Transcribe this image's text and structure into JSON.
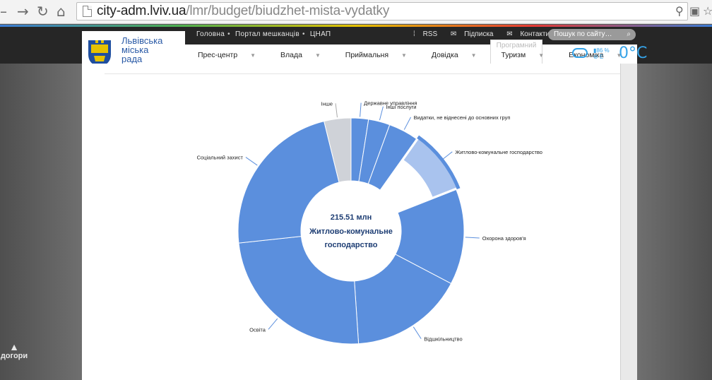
{
  "browser": {
    "url_host": "city-adm.lviv.ua",
    "url_path": "/lmr/budget/biudzhet-mista-vydatky"
  },
  "header": {
    "top_links": [
      "Головна",
      "Портал мешканців",
      "ЦНАП"
    ],
    "util_links": [
      "RSS",
      "Підписка",
      "Контакти"
    ],
    "search_placeholder": "Пошук по сайту…",
    "logo_lines": [
      "Львівська",
      "міська",
      "рада"
    ],
    "menu": [
      "Прес-центр",
      "Влада",
      "Приймальня",
      "Довідка",
      "Туризм",
      "Економіка"
    ],
    "menu_overlay": "Програмний",
    "weather": {
      "humidity": "86 %",
      "wind": "E",
      "temperature": "0°C"
    }
  },
  "sidebar": {
    "scroll_top_label": "догори"
  },
  "chart_data": {
    "type": "pie",
    "donut": true,
    "selected": "Житлово-комунальне господарство",
    "center": {
      "value": "215.51 млн",
      "label_lines": [
        "Житлово-комунальне",
        "господарство"
      ]
    },
    "slices": [
      {
        "name": "Державне управління",
        "value": 58,
        "color": "#5b8fdd"
      },
      {
        "name": "Інші послуги",
        "value": 72,
        "color": "#5b8fdd"
      },
      {
        "name": "Видатки, не віднесені до основних груп",
        "value": 100,
        "color": "#5b8fdd"
      },
      {
        "name": "Житлово-комунальне господарство",
        "value": 215.51,
        "color": "#a9c3ee"
      },
      {
        "name": "Охорона здоров'я",
        "value": 320,
        "color": "#5b8fdd"
      },
      {
        "name": "Відшкільництво",
        "value": 380,
        "color": "#5b8fdd"
      },
      {
        "name": "Освіта",
        "value": 570,
        "color": "#5b8fdd"
      },
      {
        "name": "Соціальний захист",
        "value": 535,
        "color": "#5b8fdd"
      },
      {
        "name": "Інше",
        "value": 90,
        "color": "#cfd2d8"
      }
    ]
  }
}
